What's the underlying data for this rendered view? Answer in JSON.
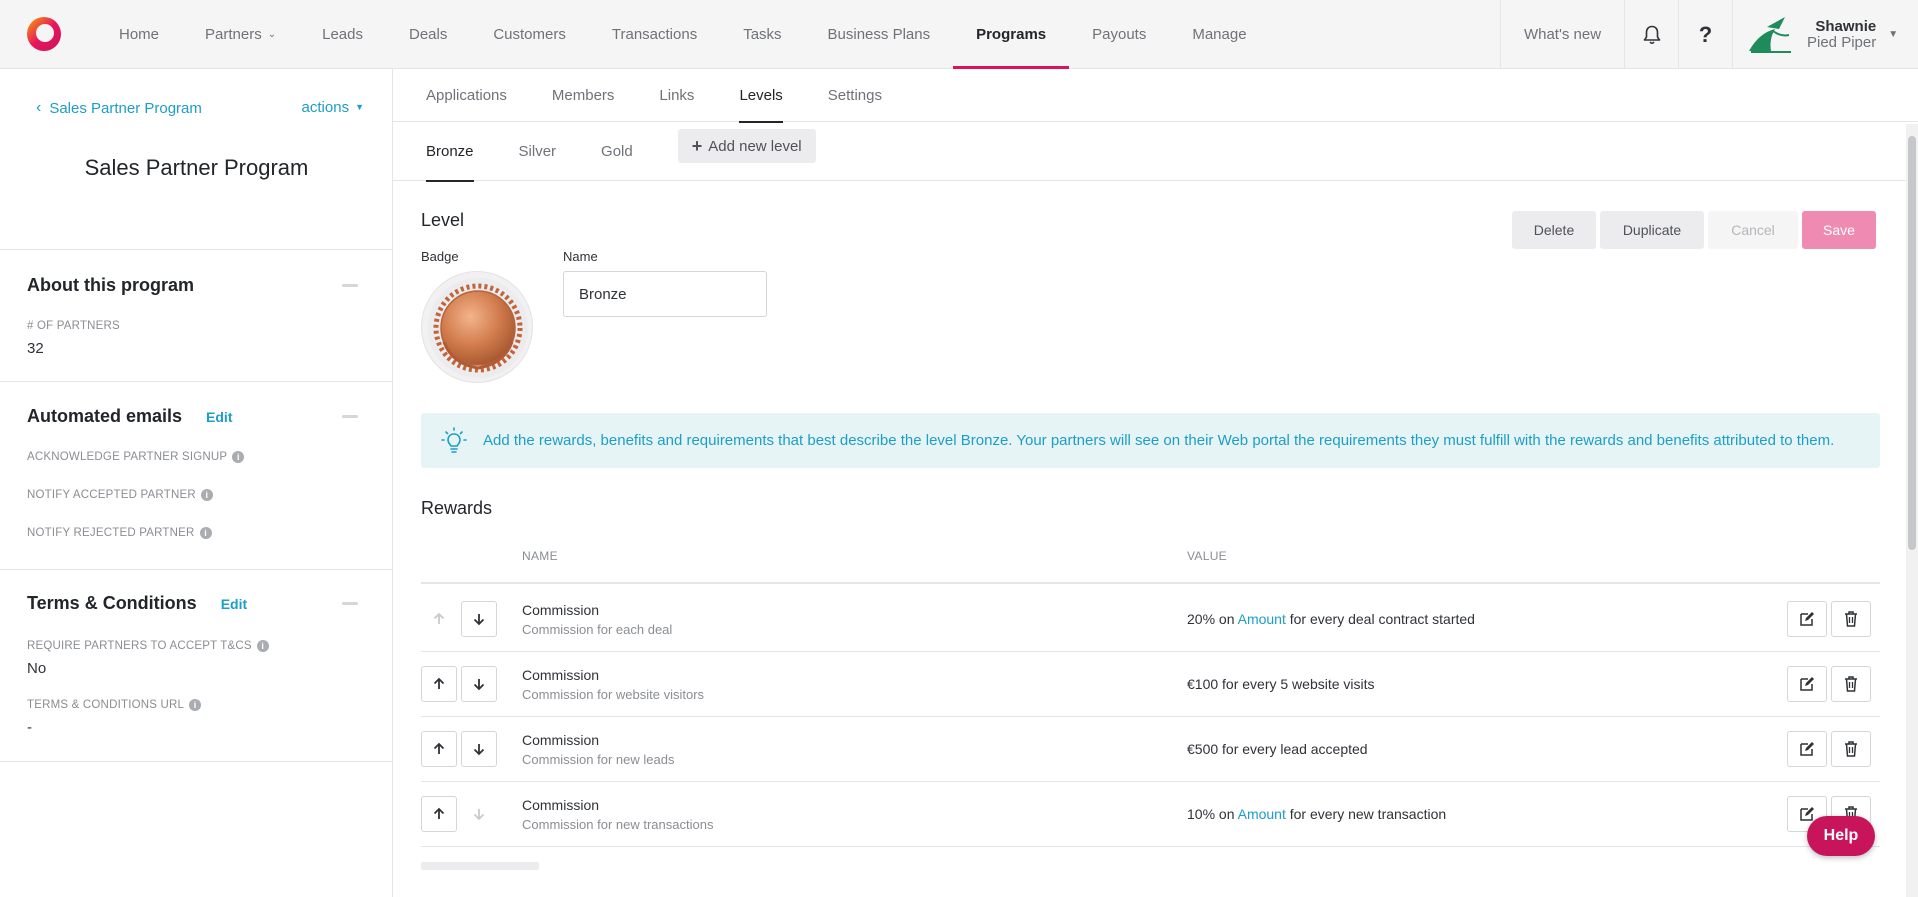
{
  "nav": {
    "items": [
      {
        "label": "Home",
        "active": false,
        "dropdown": false
      },
      {
        "label": "Partners",
        "active": false,
        "dropdown": true
      },
      {
        "label": "Leads",
        "active": false,
        "dropdown": false
      },
      {
        "label": "Deals",
        "active": false,
        "dropdown": false
      },
      {
        "label": "Customers",
        "active": false,
        "dropdown": false
      },
      {
        "label": "Transactions",
        "active": false,
        "dropdown": false
      },
      {
        "label": "Tasks",
        "active": false,
        "dropdown": false
      },
      {
        "label": "Business Plans",
        "active": false,
        "dropdown": false
      },
      {
        "label": "Programs",
        "active": true,
        "dropdown": false
      },
      {
        "label": "Payouts",
        "active": false,
        "dropdown": false
      },
      {
        "label": "Manage",
        "active": false,
        "dropdown": false
      }
    ],
    "whats_new": "What's new",
    "help_icon_label": "?",
    "user": {
      "name": "Shawnie",
      "company": "Pied Piper"
    },
    "accent_color": "#d9145f"
  },
  "sidebar": {
    "back_label": "Sales Partner Program",
    "actions_label": "actions",
    "program_title": "Sales Partner Program",
    "about": {
      "heading": "About this program",
      "partners_label": "# OF PARTNERS",
      "partners_value": "32"
    },
    "emails": {
      "heading": "Automated emails",
      "edit_label": "Edit",
      "items": [
        "ACKNOWLEDGE PARTNER SIGNUP",
        "NOTIFY ACCEPTED PARTNER",
        "NOTIFY REJECTED PARTNER"
      ]
    },
    "terms": {
      "heading": "Terms & Conditions",
      "edit_label": "Edit",
      "require_label": "REQUIRE PARTNERS TO ACCEPT T&CS",
      "require_value": "No",
      "url_label": "TERMS & CONDITIONS URL",
      "url_value": "-"
    }
  },
  "tabs": [
    {
      "label": "Applications",
      "active": false
    },
    {
      "label": "Members",
      "active": false
    },
    {
      "label": "Links",
      "active": false
    },
    {
      "label": "Levels",
      "active": true
    },
    {
      "label": "Settings",
      "active": false
    }
  ],
  "levels": {
    "tabs": [
      {
        "label": "Bronze",
        "active": true
      },
      {
        "label": "Silver",
        "active": false
      },
      {
        "label": "Gold",
        "active": false
      }
    ],
    "add_label": "Add new level"
  },
  "level": {
    "heading": "Level",
    "badge_label": "Badge",
    "name_label": "Name",
    "name_value": "Bronze",
    "buttons": {
      "delete": "Delete",
      "duplicate": "Duplicate",
      "cancel": "Cancel",
      "save": "Save"
    }
  },
  "tip": {
    "text": "Add the rewards, benefits and requirements that best describe the level Bronze. Your partners will see on their Web portal the requirements they must fulfill with the rewards and benefits attributed to them."
  },
  "rewards": {
    "heading": "Rewards",
    "columns": {
      "name": "NAME",
      "value": "VALUE"
    },
    "rows": [
      {
        "name": "Commission",
        "desc": "Commission for each deal",
        "value_pre": "20% on ",
        "value_link": "Amount",
        "value_post": " for every deal contract started",
        "up_enabled": false,
        "down_enabled": true
      },
      {
        "name": "Commission",
        "desc": "Commission for website visitors",
        "value_pre": "€100 for every 5 website visits",
        "value_link": "",
        "value_post": "",
        "up_enabled": true,
        "down_enabled": true
      },
      {
        "name": "Commission",
        "desc": "Commission for new leads",
        "value_pre": "€500 for every lead accepted",
        "value_link": "",
        "value_post": "",
        "up_enabled": true,
        "down_enabled": true
      },
      {
        "name": "Commission",
        "desc": "Commission for new transactions",
        "value_pre": "10% on ",
        "value_link": "Amount",
        "value_post": " for every new transaction",
        "up_enabled": true,
        "down_enabled": false
      }
    ]
  },
  "help_button": "Help"
}
